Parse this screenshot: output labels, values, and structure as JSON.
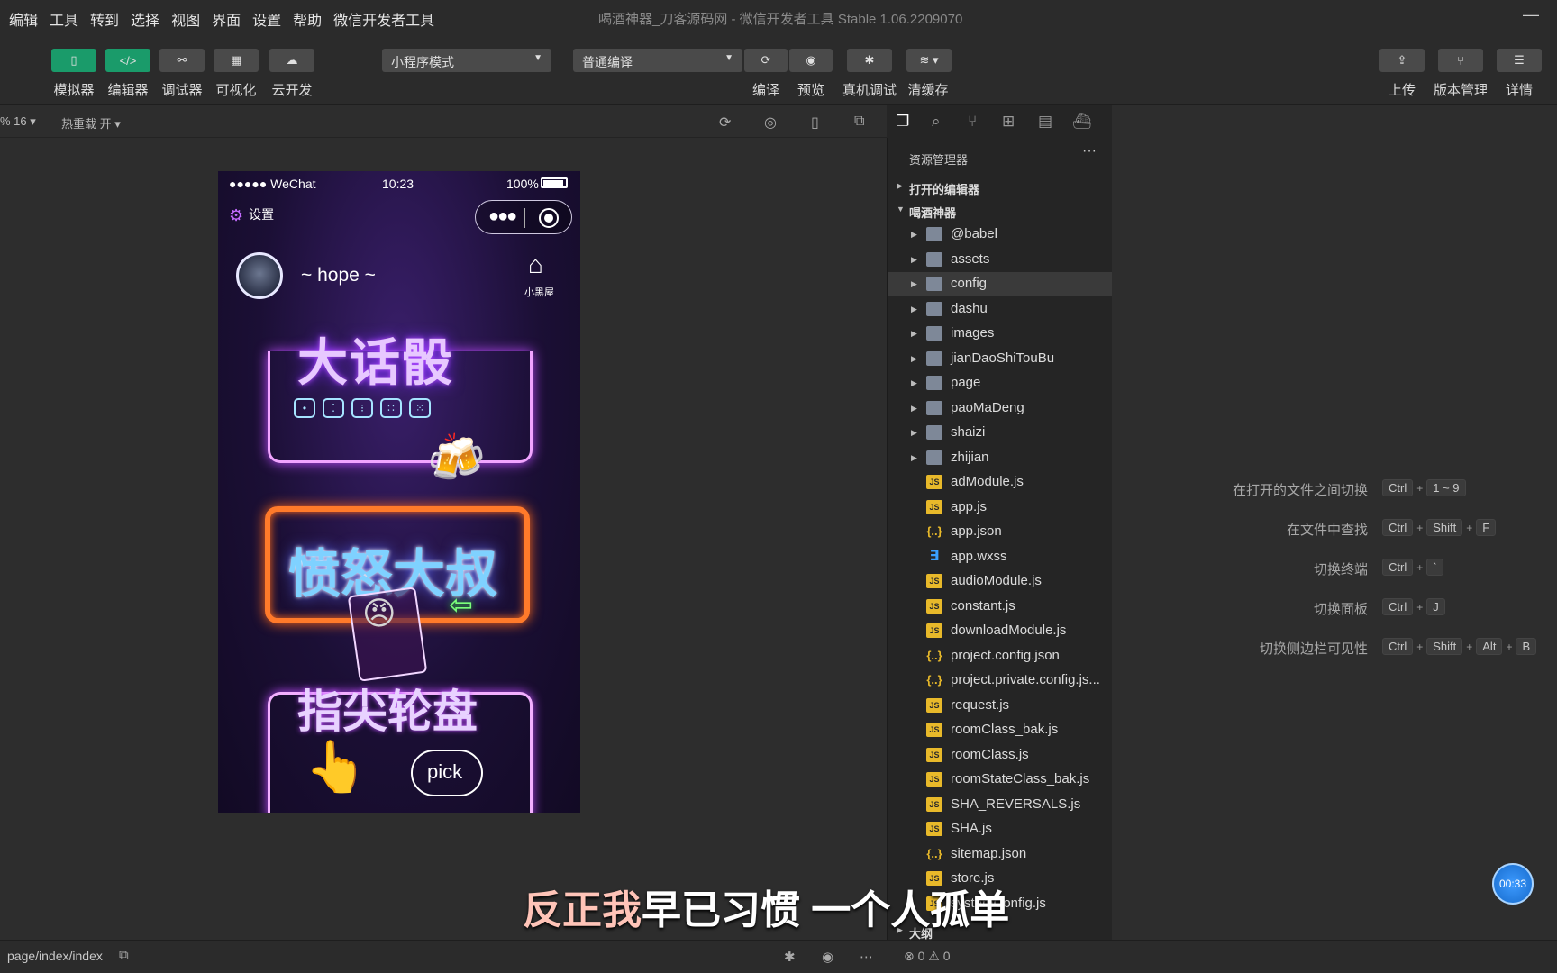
{
  "menubar": {
    "items": [
      "编辑",
      "工具",
      "转到",
      "选择",
      "视图",
      "界面",
      "设置",
      "帮助",
      "微信开发者工具"
    ],
    "title": "喝酒神器_刀客源码网 - 微信开发者工具 Stable 1.06.2209070",
    "minimize": "—"
  },
  "toolbar": {
    "simulator": "模拟器",
    "editor": "编辑器",
    "debugger": "调试器",
    "visual": "可视化",
    "cloud": "云开发",
    "mode": "小程序模式",
    "compile_mode": "普通编译",
    "compile": "编译",
    "preview": "预览",
    "remote_debug": "真机调试",
    "clear_cache": "清缓存",
    "upload": "上传",
    "version": "版本管理",
    "details": "详情"
  },
  "simbar": {
    "zoom": "% 16 ▾",
    "hot_reload": "热重载 开 ▾"
  },
  "phone": {
    "carrier": "●●●●● WeChat",
    "time": "10:23",
    "battery": "100%",
    "settings": "设置",
    "username": "~ hope ~",
    "house_label": "小黑屋",
    "game1": "大话骰",
    "game2": "愤怒大叔",
    "game3": "指尖轮盘",
    "pick": "pick"
  },
  "explorer": {
    "header": "资源管理器",
    "more": "···",
    "open_editors": "打开的编辑器",
    "project": "喝酒神器",
    "outline": "大纲",
    "items": [
      {
        "name": "@babel",
        "type": "folder",
        "expandable": true
      },
      {
        "name": "assets",
        "type": "folder",
        "expandable": true
      },
      {
        "name": "config",
        "type": "folder",
        "expandable": true,
        "selected": true
      },
      {
        "name": "dashu",
        "type": "folder",
        "expandable": true
      },
      {
        "name": "images",
        "type": "folder",
        "expandable": true
      },
      {
        "name": "jianDaoShiTouBu",
        "type": "folder",
        "expandable": true
      },
      {
        "name": "page",
        "type": "folder",
        "expandable": true
      },
      {
        "name": "paoMaDeng",
        "type": "folder",
        "expandable": true
      },
      {
        "name": "shaizi",
        "type": "folder",
        "expandable": true
      },
      {
        "name": "zhijian",
        "type": "folder",
        "expandable": true
      },
      {
        "name": "adModule.js",
        "type": "js"
      },
      {
        "name": "app.js",
        "type": "js"
      },
      {
        "name": "app.json",
        "type": "json"
      },
      {
        "name": "app.wxss",
        "type": "css"
      },
      {
        "name": "audioModule.js",
        "type": "js"
      },
      {
        "name": "constant.js",
        "type": "js"
      },
      {
        "name": "downloadModule.js",
        "type": "js"
      },
      {
        "name": "project.config.json",
        "type": "json"
      },
      {
        "name": "project.private.config.js...",
        "type": "json"
      },
      {
        "name": "request.js",
        "type": "js"
      },
      {
        "name": "roomClass_bak.js",
        "type": "js"
      },
      {
        "name": "roomClass.js",
        "type": "js"
      },
      {
        "name": "roomStateClass_bak.js",
        "type": "js"
      },
      {
        "name": "SHA_REVERSALS.js",
        "type": "js"
      },
      {
        "name": "SHA.js",
        "type": "js"
      },
      {
        "name": "sitemap.json",
        "type": "json"
      },
      {
        "name": "store.js",
        "type": "js"
      },
      {
        "name": "systemConfig.js",
        "type": "js"
      }
    ]
  },
  "shortcuts": [
    {
      "label": "在打开的文件之间切换",
      "keys": [
        "Ctrl",
        "1 ~ 9"
      ]
    },
    {
      "label": "在文件中查找",
      "keys": [
        "Ctrl",
        "Shift",
        "F"
      ]
    },
    {
      "label": "切换终端",
      "keys": [
        "Ctrl",
        "`"
      ]
    },
    {
      "label": "切换面板",
      "keys": [
        "Ctrl",
        "J"
      ]
    },
    {
      "label": "切换侧边栏可见性",
      "keys": [
        "Ctrl",
        "Shift",
        "Alt",
        "B"
      ]
    }
  ],
  "timer": "00:33",
  "subtitle": {
    "highlight": "反正我",
    "rest": "早已习惯 一个人孤单"
  },
  "statusbar": {
    "path": "page/index/index",
    "errors": "⊗ 0 ⚠ 0"
  }
}
